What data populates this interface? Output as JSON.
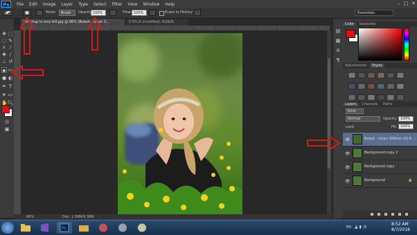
{
  "app": {
    "logo": "Ps"
  },
  "menu": [
    "File",
    "Edit",
    "Image",
    "Layer",
    "Type",
    "Select",
    "Filter",
    "View",
    "Window",
    "Help"
  ],
  "window_controls": [
    "–",
    "□",
    "✕"
  ],
  "options": {
    "mode_label": "Mode:",
    "mode_value": "Brush",
    "opacity_label": "Opacity:",
    "opacity_value": "100%",
    "flow_label": "Flow:",
    "flow_value": "100%",
    "erase_history": "Erase to History",
    "workspace": "Essentials"
  },
  "tabs": [
    {
      "label": "lkh chup ts lens bill.jpg @ 66% (Bokeh - Ivkan 3...",
      "active": true
    },
    {
      "label": "0 0%.6 (modified), RGB/8)",
      "active": false
    }
  ],
  "status": {
    "zoom": "66%",
    "doc": "Doc: 1.09M/9.36M"
  },
  "panels": {
    "color_tabs": [
      "Color",
      "Swatches"
    ],
    "adjust_tabs": [
      "Adjustments",
      "Styles"
    ],
    "layers_tabs": [
      "Layers",
      "Channels",
      "Paths"
    ],
    "kind": "Kind",
    "blend_mode": "Normal",
    "opacity_label": "Opacity:",
    "opacity_value": "100%",
    "lock_label": "Lock:",
    "fill_label": "Fill:",
    "fill_value": "100%",
    "layers": [
      {
        "name": "Bokeh - Ivkan 300mm f/2.8 ...",
        "selected": true,
        "thumb": "#3e6a2e"
      },
      {
        "name": "Background copy 2",
        "selected": false,
        "thumb": "#4c7a36"
      },
      {
        "name": "Background copy",
        "selected": false,
        "thumb": "#4c7a36"
      },
      {
        "name": "Background",
        "selected": false,
        "thumb": "#4c7a36",
        "lock": "🔒"
      }
    ]
  },
  "taskbar": {
    "lang": "EN",
    "time": "8:52 AM",
    "date": "8/7/2016"
  },
  "colors": {
    "foreground": "#e01010",
    "background": "#ffffff",
    "arrow": "#d61a1a"
  }
}
